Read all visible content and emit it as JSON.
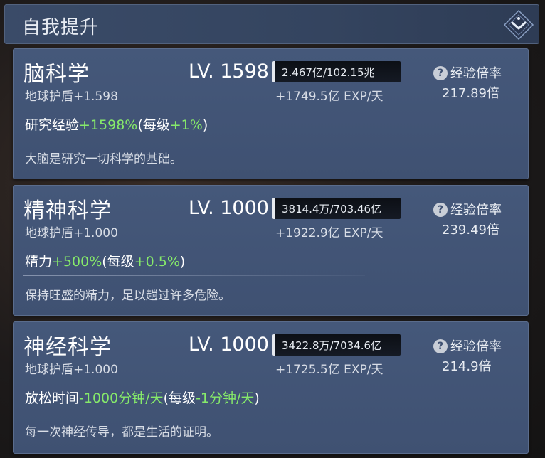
{
  "header": {
    "title": "自我提升"
  },
  "skills": [
    {
      "name": "脑科学",
      "shield": "地球护盾+1.598",
      "level": "LV. 1598",
      "xp": "2.467亿/102.15兆",
      "rate": "+1749.5亿 EXP/天",
      "mult_label": "经验倍率",
      "mult_value": "217.89倍",
      "effect": {
        "name": "研究经验",
        "value": "+1598%",
        "per_open": "(每级",
        "per_value": "+1%",
        "per_close": ")"
      },
      "desc": "大脑是研究一切科学的基础。"
    },
    {
      "name": "精神科学",
      "shield": "地球护盾+1.000",
      "level": "LV. 1000",
      "xp": "3814.4万/703.46亿",
      "rate": "+1922.9亿 EXP/天",
      "mult_label": "经验倍率",
      "mult_value": "239.49倍",
      "effect": {
        "name": "精力",
        "value": "+500%",
        "per_open": "(每级",
        "per_value": "+0.5%",
        "per_close": ")"
      },
      "desc": "保持旺盛的精力，足以趟过许多危险。"
    },
    {
      "name": "神经科学",
      "shield": "地球护盾+1.000",
      "level": "LV. 1000",
      "xp": "3422.8万/7034.6亿",
      "rate": "+1725.5亿 EXP/天",
      "mult_label": "经验倍率",
      "mult_value": "214.9倍",
      "effect": {
        "name": "放松时间",
        "value": "-1000分钟/天",
        "per_open": "(每级",
        "per_value": "-1分钟/天",
        "per_close": ")"
      },
      "desc": "每一次神经传导，都是生活的证明。"
    }
  ],
  "icons": {
    "help": "help-circle-icon",
    "collapse": "chevron-down-diamond-icon"
  },
  "colors": {
    "accent_green": "#86ea6a",
    "card_bg": "#45587a"
  }
}
